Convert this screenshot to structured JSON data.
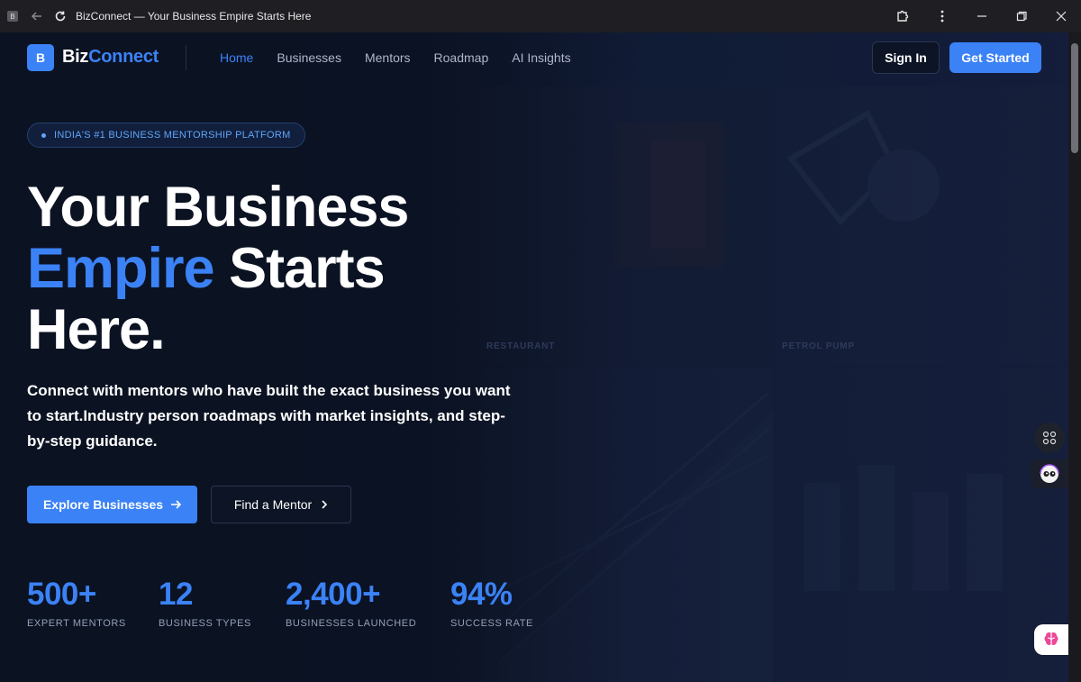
{
  "browser": {
    "tab_title": "BizConnect — Your Business Empire Starts Here",
    "favicon_letter": "B"
  },
  "header": {
    "logo_letter": "B",
    "logo_biz": "Biz",
    "logo_connect": "Connect",
    "nav": [
      {
        "label": "Home",
        "active": true
      },
      {
        "label": "Businesses",
        "active": false
      },
      {
        "label": "Mentors",
        "active": false
      },
      {
        "label": "Roadmap",
        "active": false
      },
      {
        "label": "AI Insights",
        "active": false
      }
    ],
    "sign_in": "Sign In",
    "get_started": "Get Started"
  },
  "hero": {
    "badge": "INDIA'S #1 BUSINESS MENTORSHIP PLATFORM",
    "title_line1": "Your Business",
    "title_accent": "Empire",
    "title_line2_rest": " Starts",
    "title_line3": "Here.",
    "subtitle": "Connect with mentors who have built the exact business you want to start.Industry person roadmaps with market insights, and step-by-step guidance.",
    "explore_button": "Explore Businesses",
    "mentor_button": "Find a Mentor"
  },
  "background_labels": {
    "restaurant": "RESTAURANT",
    "petrol_pump": "PETROL PUMP"
  },
  "stats": [
    {
      "value": "500+",
      "label": "EXPERT MENTORS"
    },
    {
      "value": "12",
      "label": "BUSINESS TYPES"
    },
    {
      "value": "2,400+",
      "label": "BUSINESSES LAUNCHED"
    },
    {
      "value": "94%",
      "label": "SUCCESS RATE"
    }
  ],
  "colors": {
    "accent": "#3b82f6",
    "background": "#0b1222"
  },
  "icons": {
    "back": "arrow-left-icon",
    "reload": "reload-icon",
    "extension": "puzzle-icon",
    "menu": "kebab-menu-icon",
    "minimize": "minimize-icon",
    "restore": "restore-icon",
    "close": "close-icon",
    "arrow": "arrow-right-icon",
    "chevron": "chevron-right-icon"
  }
}
